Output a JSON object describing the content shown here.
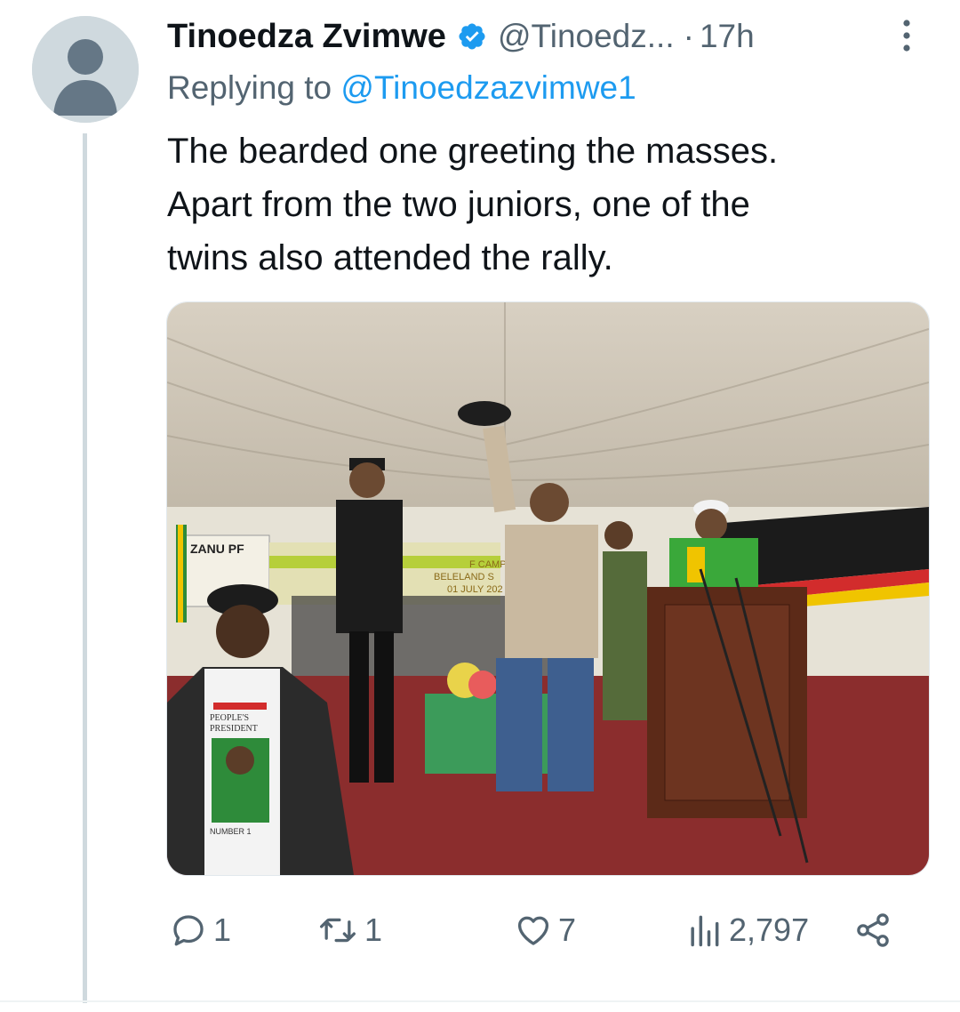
{
  "author": {
    "name": "Tinoedza Zvimwe",
    "handle": "@Tinoedz...",
    "separator": "·",
    "time": "17h",
    "verified": true,
    "avatar_icon": "default-avatar-icon"
  },
  "replying": {
    "prefix": "Replying to ",
    "mention": "@Tinoedzazvimwe1"
  },
  "tweet": {
    "lines": [
      "The bearded one greeting the masses.",
      "Apart from the two juniors, one of the",
      "twins also attended the rally."
    ]
  },
  "media": {
    "sign_text": "ZANU PF",
    "banner_lines": [
      "F CAMPA",
      "BELELAND S",
      "01 JULY 202"
    ],
    "shirt_lines": [
      "PEOPLE'S",
      "PRESIDENT",
      "NUMBER 1"
    ]
  },
  "actions": {
    "reply_count": "1",
    "retweet_count": "1",
    "like_count": "7",
    "views_count": "2,797"
  },
  "colors": {
    "accent": "#1d9bf0",
    "muted": "#536471",
    "text": "#0f1419"
  }
}
